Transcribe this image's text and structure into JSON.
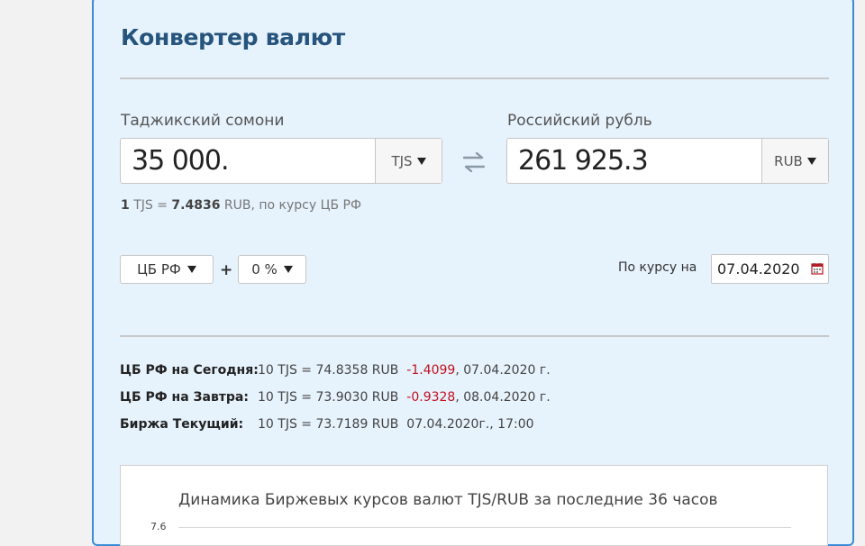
{
  "converter": {
    "title": "Конвертер валют",
    "from": {
      "label": "Таджикский сомони",
      "value": "35 000.",
      "currency": "TJS"
    },
    "to": {
      "label": "Российский рубль",
      "value": "261 925.3",
      "currency": "RUB"
    },
    "swap_icon": "swap-arrows-icon",
    "rate_line": {
      "amount": "1",
      "from_code": " TJS = ",
      "rate": "7.4836",
      "suffix": " RUB, по курсу ЦБ РФ"
    },
    "source_select": "ЦБ РФ",
    "plus": "+",
    "margin_select": "0 %",
    "date_label": "По курсу на",
    "date_value": "07.04.2020",
    "calendar_icon": "calendar-icon"
  },
  "rates": [
    {
      "label": "ЦБ РФ на Сегодня:",
      "value": "10 TJS = 74.8358 RUB",
      "change": "-1.4099",
      "tail": ", 07.04.2020 г."
    },
    {
      "label": "ЦБ РФ на Завтра:",
      "value": "10 TJS = 73.9030 RUB",
      "change": "-0.9328",
      "tail": ", 08.04.2020 г."
    },
    {
      "label": "Биржа Текущий:",
      "value": "10 TJS = 73.7189 RUB",
      "change": "",
      "tail": "07.04.2020г., 17:00"
    }
  ],
  "chart_data": {
    "type": "line",
    "title": "Динамика Биржевых курсов валют TJS/RUB за последние 36 часов",
    "y_ticks": [
      "7.6"
    ],
    "series": []
  },
  "colors": {
    "panel_bg": "#e6f2fc",
    "panel_border": "#3d8bd4",
    "title": "#26547c",
    "negative": "#c0121f"
  }
}
